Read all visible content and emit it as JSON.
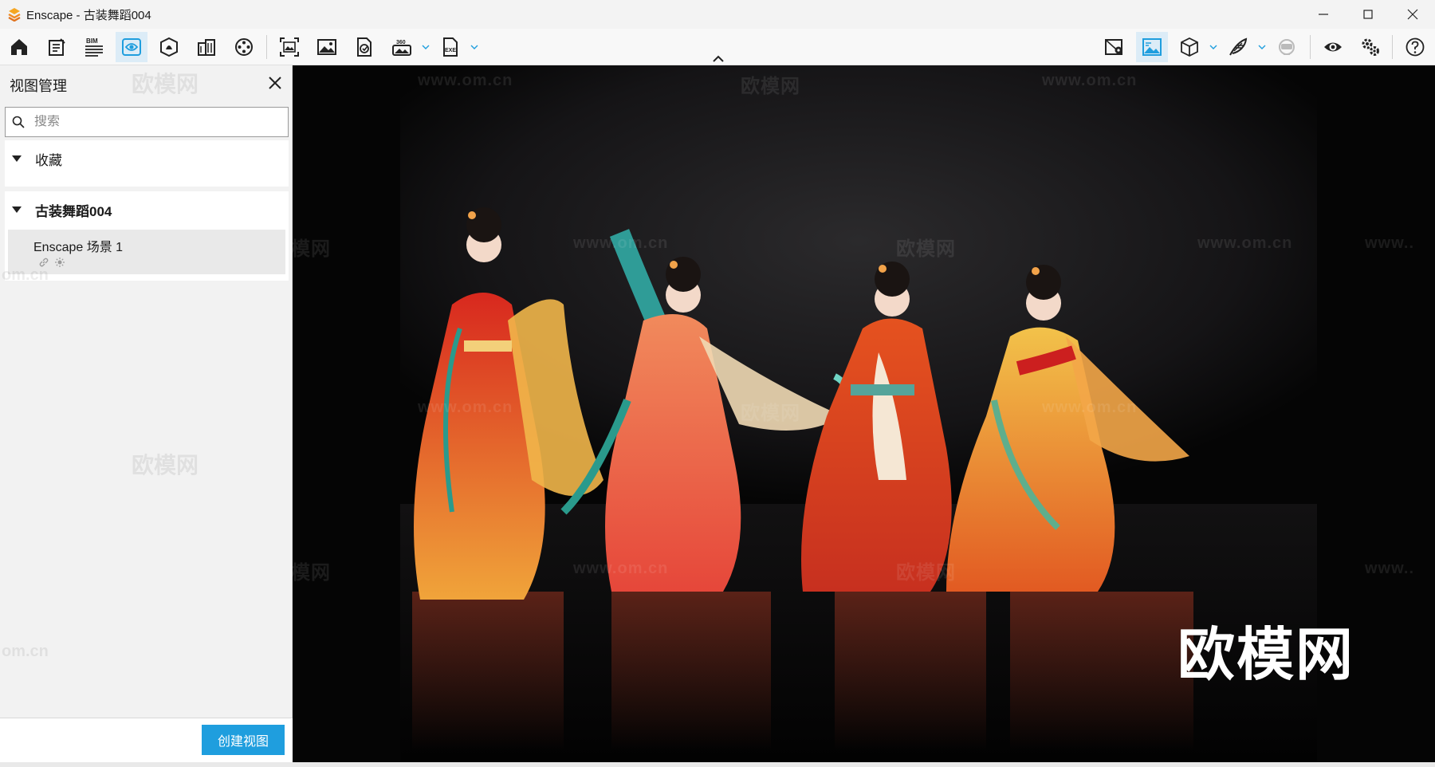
{
  "window": {
    "title": "Enscape - 古装舞蹈004"
  },
  "toolbar": {
    "bim_label": "BIM",
    "label_360": "360",
    "exe_label": "EXE",
    "left_buttons": [
      {
        "icon": "home-icon"
      },
      {
        "icon": "notes-icon"
      },
      {
        "icon": "bim-info-icon"
      },
      {
        "icon": "view-management-icon",
        "active": true
      },
      {
        "icon": "asset-library-icon"
      },
      {
        "icon": "material-editor-icon"
      },
      {
        "icon": "video-editor-icon"
      },
      {
        "icon": "screenshot-icon"
      },
      {
        "icon": "batch-render-icon"
      },
      {
        "icon": "export-pano-icon"
      },
      {
        "icon": "render-360-icon"
      },
      {
        "icon": "export-exe-icon"
      }
    ],
    "right_buttons": [
      {
        "icon": "map-location-icon"
      },
      {
        "icon": "atmosphere-icon",
        "active": true
      },
      {
        "icon": "cube-view-icon"
      },
      {
        "icon": "feather-icon"
      },
      {
        "icon": "vr-headset-icon"
      },
      {
        "icon": "visibility-icon"
      },
      {
        "icon": "settings-icon"
      },
      {
        "icon": "help-icon"
      }
    ],
    "accent_color": "#1f9ede"
  },
  "sidebar": {
    "title": "视图管理",
    "search_placeholder": "搜索",
    "groups": [
      {
        "label": "收藏",
        "expanded": true,
        "items": []
      },
      {
        "label": "古装舞蹈004",
        "expanded": true,
        "items": [
          {
            "label": "Enscape 场景 1"
          }
        ]
      }
    ],
    "create_button": "创建视图"
  },
  "viewport": {
    "watermark_brand": "欧模网",
    "watermark_url": "www.om.cn",
    "watermark_url_partial": "om.cn",
    "watermark_edge": "www.."
  }
}
